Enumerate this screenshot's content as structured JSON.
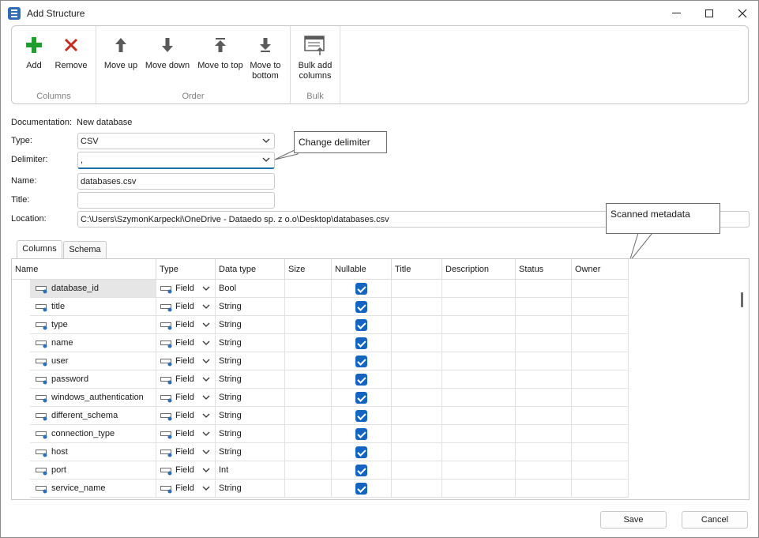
{
  "window": {
    "title": "Add Structure"
  },
  "ribbon": {
    "groups": [
      {
        "label": "Columns",
        "buttons": [
          {
            "label": "Add",
            "icon": "plus-icon"
          },
          {
            "label": "Remove",
            "icon": "x-icon"
          }
        ]
      },
      {
        "label": "Order",
        "buttons": [
          {
            "label": "Move up",
            "icon": "arrow-up-icon"
          },
          {
            "label": "Move down",
            "icon": "arrow-down-icon"
          },
          {
            "label": "Move to top",
            "icon": "arrow-top-icon"
          },
          {
            "label": "Move to bottom",
            "icon": "arrow-bottom-icon"
          }
        ]
      },
      {
        "label": "Bulk",
        "buttons": [
          {
            "label": "Bulk add columns",
            "icon": "bulk-add-icon"
          }
        ]
      }
    ]
  },
  "form": {
    "documentation": {
      "label": "Documentation:",
      "value": "New database"
    },
    "type": {
      "label": "Type:",
      "value": "CSV"
    },
    "delimiter": {
      "label": "Delimiter:",
      "value": ","
    },
    "name": {
      "label": "Name:",
      "value": "databases.csv"
    },
    "title": {
      "label": "Title:",
      "value": ""
    },
    "location": {
      "label": "Location:",
      "value": "C:\\Users\\SzymonKarpecki\\OneDrive - Dataedo sp. z o.o\\Desktop\\databases.csv"
    }
  },
  "callouts": {
    "delimiter": "Change delimiter",
    "metadata": "Scanned metadata"
  },
  "tabs": [
    "Columns",
    "Schema"
  ],
  "grid": {
    "headers": [
      "Name",
      "Type",
      "Data type",
      "Size",
      "Nullable",
      "Title",
      "Description",
      "Status",
      "Owner"
    ],
    "rows": [
      {
        "name": "database_id",
        "type": "Field",
        "data_type": "Bool",
        "nullable": true
      },
      {
        "name": "title",
        "type": "Field",
        "data_type": "String",
        "nullable": true
      },
      {
        "name": "type",
        "type": "Field",
        "data_type": "String",
        "nullable": true
      },
      {
        "name": "name",
        "type": "Field",
        "data_type": "String",
        "nullable": true
      },
      {
        "name": "user",
        "type": "Field",
        "data_type": "String",
        "nullable": true
      },
      {
        "name": "password",
        "type": "Field",
        "data_type": "String",
        "nullable": true
      },
      {
        "name": "windows_authentication",
        "type": "Field",
        "data_type": "String",
        "nullable": true
      },
      {
        "name": "different_schema",
        "type": "Field",
        "data_type": "String",
        "nullable": true
      },
      {
        "name": "connection_type",
        "type": "Field",
        "data_type": "String",
        "nullable": true
      },
      {
        "name": "host",
        "type": "Field",
        "data_type": "String",
        "nullable": true
      },
      {
        "name": "port",
        "type": "Field",
        "data_type": "Int",
        "nullable": true
      },
      {
        "name": "service_name",
        "type": "Field",
        "data_type": "String",
        "nullable": true
      }
    ]
  },
  "footer": {
    "save": "Save",
    "cancel": "Cancel"
  },
  "colors": {
    "accent": "#1565c0",
    "add_green": "#1f9e2f",
    "remove_red": "#c42b1c"
  }
}
